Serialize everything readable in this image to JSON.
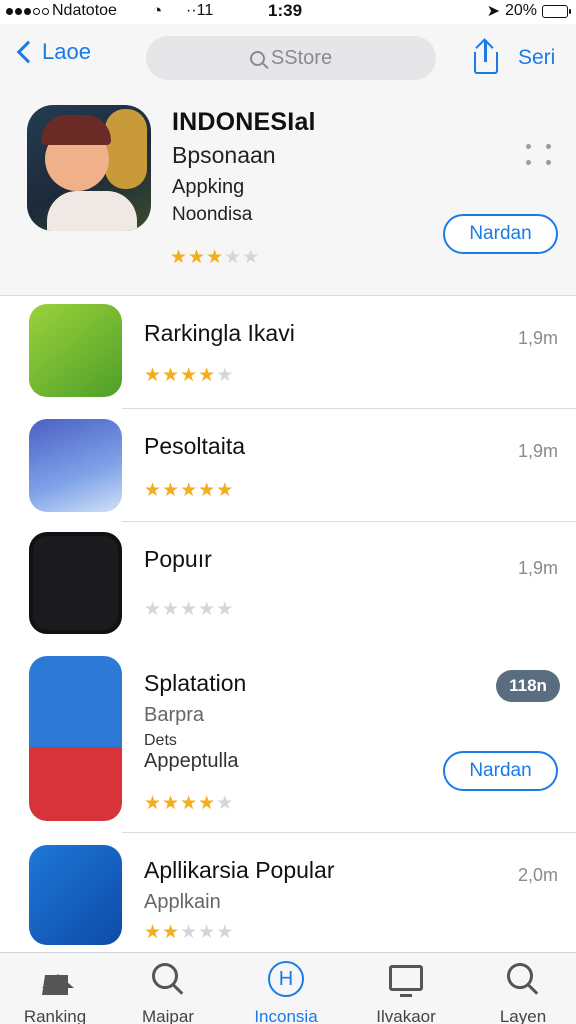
{
  "status_bar": {
    "carrier": "Ndatotoe",
    "network": "11",
    "time": "1:39",
    "battery": "20%",
    "battery_level": 0.2
  },
  "navbar": {
    "back_label": "Laoe",
    "search_placeholder": "SStore",
    "right_label": "Seri"
  },
  "featured": {
    "title": "INDONESIal",
    "subtitle": "Bpsonaan",
    "line2": "Appking",
    "line3": "Noondisa",
    "rating": 2.5,
    "button_label": "Nardan"
  },
  "apps": [
    {
      "name": "Rarkingla Ikavi",
      "size": "1,9m",
      "rating": 3.5
    },
    {
      "name": "Pesoltaita",
      "size": "1,9m",
      "rating": 5
    },
    {
      "name": "Popuır",
      "size": "1,9m",
      "rating": 0
    },
    {
      "name": "Splatation",
      "badge": "118n",
      "sub1": "Barpra",
      "sub2": "Dets",
      "sub3": "Appeptulla",
      "button_label": "Nardan",
      "rating": 3.5
    },
    {
      "name": "Apllikarsia Popular",
      "size": "2,0m",
      "sub1": "Applkain",
      "rating": 1.5
    }
  ],
  "tabs": [
    {
      "label": "Ranking",
      "icon": "home-icon"
    },
    {
      "label": "Maipar",
      "icon": "search-icon"
    },
    {
      "label": "Inconsia",
      "icon": "globe-icon",
      "active": true
    },
    {
      "label": "Ilvakaor",
      "icon": "screen-icon"
    },
    {
      "label": "Layen",
      "icon": "search-icon"
    }
  ],
  "colors": {
    "accent": "#1a7be8",
    "star": "#f4ad1c",
    "badge": "#5a6d80"
  }
}
